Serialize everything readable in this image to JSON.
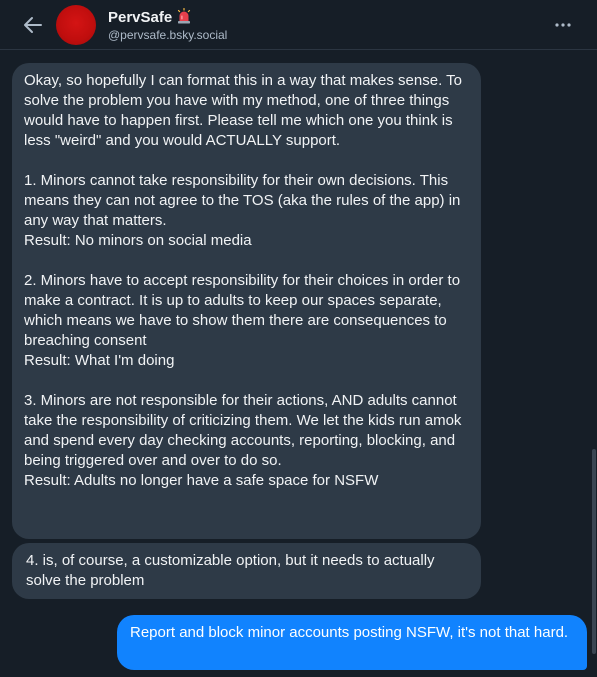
{
  "header": {
    "display_name": "PervSafe",
    "name_icon": "siren-icon",
    "handle": "@pervsafe.bsky.social",
    "back_icon": "arrow-left-icon",
    "more_icon": "ellipsis-icon"
  },
  "messages": [
    {
      "direction": "incoming",
      "text": "Okay, so hopefully I can format this in a way that makes sense. To solve the problem you have with my method, one of three things would have to happen first. Please tell me which one you think is less \"weird\" and you would ACTUALLY support.\n\n1. Minors cannot take responsibility for their own decisions. This means they can not agree to the TOS (aka the rules of the app) in any way that matters.\nResult: No minors on social media\n\n2. Minors have to accept responsibility for their choices in order to make a contract. It is up to adults to keep our spaces separate, which means we have to show them there are consequences to  breaching consent\nResult: What I'm doing\n\n3. Minors are not responsible for their actions, AND adults cannot take the responsibility of criticizing them. We let the kids run amok and spend every day checking accounts, reporting, blocking, and being triggered over and over to do so.\nResult: Adults no longer have a safe space for NSFW"
    },
    {
      "direction": "incoming",
      "text": "4. is, of course, a customizable option, but it needs to actually solve the problem"
    },
    {
      "direction": "outgoing",
      "text": "Report and block minor accounts posting NSFW, it's not that hard."
    }
  ],
  "colors": {
    "background": "#161e27",
    "incoming_bubble": "#2e3a47",
    "outgoing_bubble": "#1183fe",
    "secondary_text": "#aebbc9"
  }
}
